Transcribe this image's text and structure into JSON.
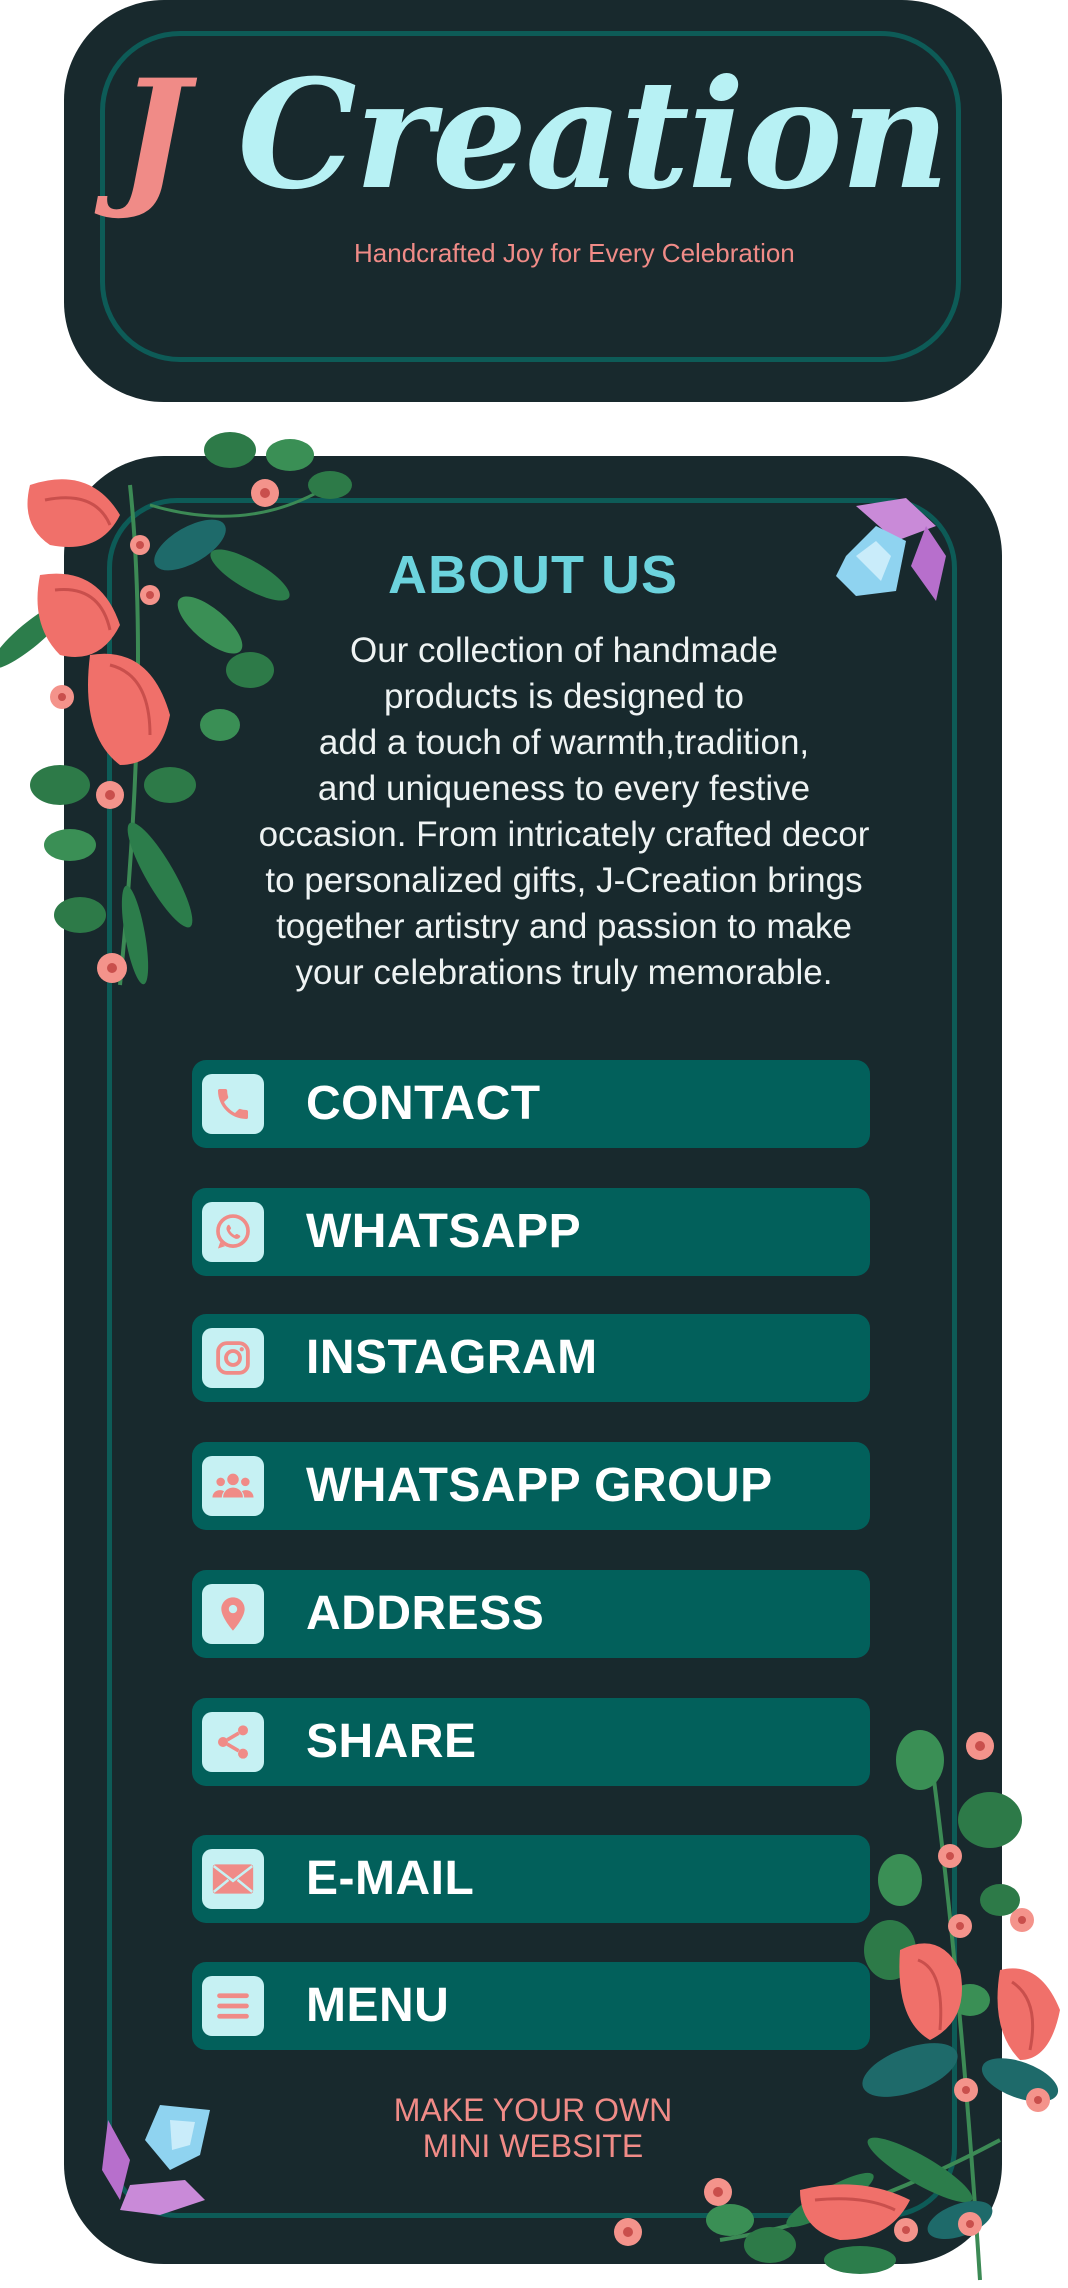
{
  "header": {
    "logo_initial": "J",
    "logo_rest": "Creation",
    "tagline": "Handcrafted Joy for Every Celebration"
  },
  "about": {
    "title": "ABOUT US",
    "text": "Our collection of handmade\nproducts is designed to\nadd a touch of warmth,tradition,\nand uniqueness to every festive\noccasion. From intricately crafted decor\nto personalized gifts, J-Creation brings\ntogether artistry and passion to make\nyour celebrations truly memorable."
  },
  "buttons": [
    {
      "label": "CONTACT",
      "icon": "phone-icon"
    },
    {
      "label": "WHATSAPP",
      "icon": "whatsapp-icon"
    },
    {
      "label": "INSTAGRAM",
      "icon": "instagram-icon"
    },
    {
      "label": "WHATSAPP GROUP",
      "icon": "group-icon"
    },
    {
      "label": "ADDRESS",
      "icon": "location-pin-icon"
    },
    {
      "label": "SHARE",
      "icon": "share-icon"
    },
    {
      "label": "E-MAIL",
      "icon": "mail-icon"
    },
    {
      "label": "MENU",
      "icon": "menu-icon"
    }
  ],
  "footer": {
    "text": "MAKE YOUR OWN\nMINI WEBSITE"
  },
  "colors": {
    "background": "#ffffff",
    "card": "#18292d",
    "border": "#0d5b57",
    "button": "#02605b",
    "icon_box": "#c6f1f3",
    "accent_pink": "#f08b87",
    "accent_cyan": "#6cd3dd"
  }
}
